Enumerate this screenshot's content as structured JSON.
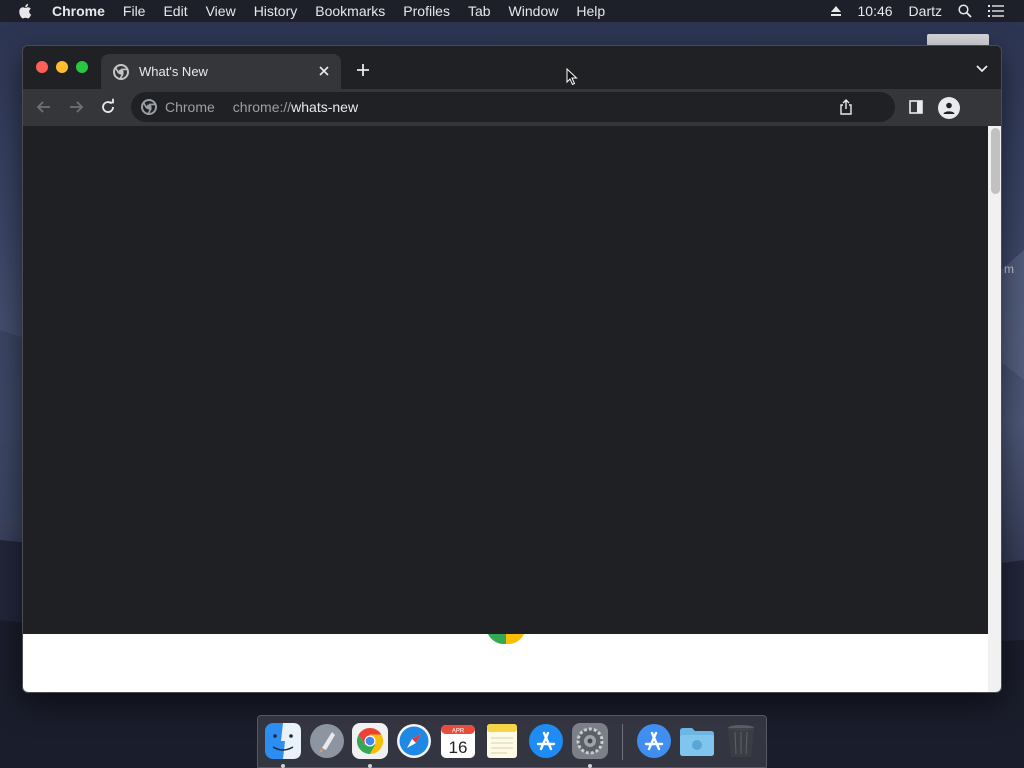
{
  "menubar": {
    "app_name": "Chrome",
    "items": [
      "File",
      "Edit",
      "View",
      "History",
      "Bookmarks",
      "Profiles",
      "Tab",
      "Window",
      "Help"
    ],
    "clock": "10:46",
    "user": "Dartz",
    "icons": [
      "apple-icon",
      "eject-icon",
      "spotlight-search-icon",
      "control-center-list-icon"
    ]
  },
  "desktop": {
    "partial_label": "m"
  },
  "browser": {
    "tab": {
      "title": "What's New",
      "favicon": "chrome-icon"
    },
    "omnibox": {
      "chip_label": "Chrome",
      "url_scheme": "chrome://",
      "url_path": "whats-new"
    },
    "colors": {
      "frame": "#202124",
      "toolbar": "#35363a",
      "content": "#1f2023"
    }
  },
  "dock": {
    "apps": [
      {
        "name": "Finder",
        "icon": "finder-icon",
        "running": true
      },
      {
        "name": "Launchpad",
        "icon": "launchpad-icon",
        "running": false
      },
      {
        "name": "Google Chrome",
        "icon": "chrome-icon",
        "running": true
      },
      {
        "name": "Safari",
        "icon": "safari-icon",
        "running": false
      },
      {
        "name": "Calendar",
        "icon": "calendar-icon",
        "running": false,
        "month": "APR",
        "day": "16"
      },
      {
        "name": "Notes",
        "icon": "notes-icon",
        "running": false
      },
      {
        "name": "App Store",
        "icon": "app-store-icon",
        "running": false
      },
      {
        "name": "System Preferences",
        "icon": "system-preferences-icon",
        "running": true
      },
      {
        "name": "Applications",
        "icon": "applications-folder-icon",
        "running": false
      },
      {
        "name": "Downloads",
        "icon": "downloads-folder-icon",
        "running": false
      },
      {
        "name": "Trash",
        "icon": "trash-icon",
        "running": false
      }
    ]
  }
}
